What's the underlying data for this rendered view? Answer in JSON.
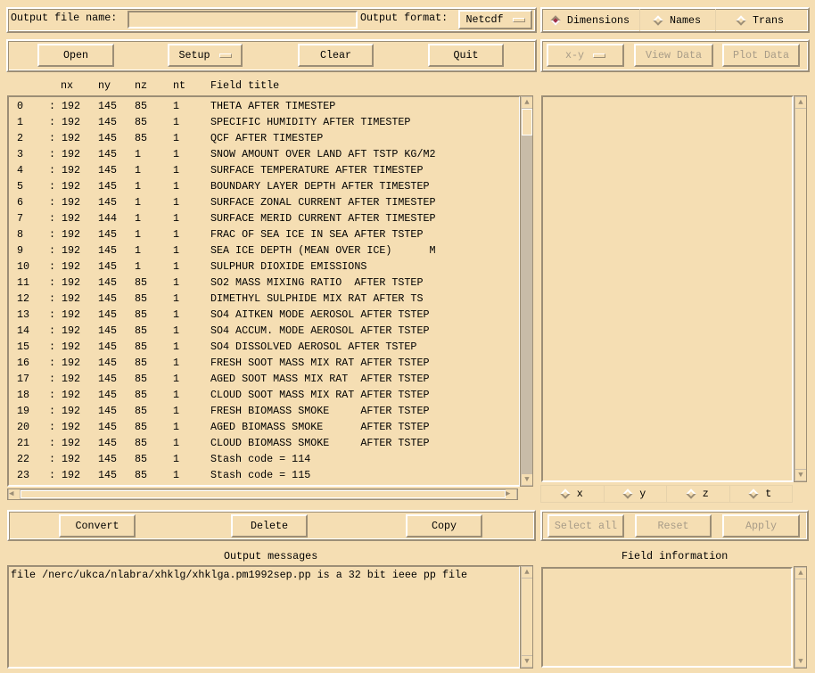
{
  "top": {
    "file_label": "Output file name:",
    "file_value": "",
    "format_label": "Output format:",
    "format_value": "Netcdf"
  },
  "view_modes": [
    {
      "label": "Dimensions",
      "selected": true
    },
    {
      "label": "Names",
      "selected": false
    },
    {
      "label": "Trans",
      "selected": false
    }
  ],
  "toolbar": {
    "open": "Open",
    "setup": "Setup",
    "clear": "Clear",
    "quit": "Quit"
  },
  "plot_toolbar": {
    "plot_type": "x-y",
    "view_data": "View Data",
    "plot_data": "Plot Data"
  },
  "list_header": {
    "nx": "nx",
    "ny": "ny",
    "nz": "nz",
    "nt": "nt",
    "title": "Field title"
  },
  "fields": [
    [
      "0",
      ": 192",
      "145",
      "85",
      "1",
      "THETA AFTER TIMESTEP"
    ],
    [
      "1",
      ": 192",
      "145",
      "85",
      "1",
      "SPECIFIC HUMIDITY AFTER TIMESTEP"
    ],
    [
      "2",
      ": 192",
      "145",
      "85",
      "1",
      "QCF AFTER TIMESTEP"
    ],
    [
      "3",
      ": 192",
      "145",
      "1",
      "1",
      "SNOW AMOUNT OVER LAND AFT TSTP KG/M2"
    ],
    [
      "4",
      ": 192",
      "145",
      "1",
      "1",
      "SURFACE TEMPERATURE AFTER TIMESTEP"
    ],
    [
      "5",
      ": 192",
      "145",
      "1",
      "1",
      "BOUNDARY LAYER DEPTH AFTER TIMESTEP"
    ],
    [
      "6",
      ": 192",
      "145",
      "1",
      "1",
      "SURFACE ZONAL CURRENT AFTER TIMESTEP"
    ],
    [
      "7",
      ": 192",
      "144",
      "1",
      "1",
      "SURFACE MERID CURRENT AFTER TIMESTEP"
    ],
    [
      "8",
      ": 192",
      "145",
      "1",
      "1",
      "FRAC OF SEA ICE IN SEA AFTER TSTEP"
    ],
    [
      "9",
      ": 192",
      "145",
      "1",
      "1",
      "SEA ICE DEPTH (MEAN OVER ICE)      M"
    ],
    [
      "10",
      ": 192",
      "145",
      "1",
      "1",
      "SULPHUR DIOXIDE EMISSIONS"
    ],
    [
      "11",
      ": 192",
      "145",
      "85",
      "1",
      "SO2 MASS MIXING RATIO  AFTER TSTEP"
    ],
    [
      "12",
      ": 192",
      "145",
      "85",
      "1",
      "DIMETHYL SULPHIDE MIX RAT AFTER TS"
    ],
    [
      "13",
      ": 192",
      "145",
      "85",
      "1",
      "SO4 AITKEN MODE AEROSOL AFTER TSTEP"
    ],
    [
      "14",
      ": 192",
      "145",
      "85",
      "1",
      "SO4 ACCUM. MODE AEROSOL AFTER TSTEP"
    ],
    [
      "15",
      ": 192",
      "145",
      "85",
      "1",
      "SO4 DISSOLVED AEROSOL AFTER TSTEP"
    ],
    [
      "16",
      ": 192",
      "145",
      "85",
      "1",
      "FRESH SOOT MASS MIX RAT AFTER TSTEP"
    ],
    [
      "17",
      ": 192",
      "145",
      "85",
      "1",
      "AGED SOOT MASS MIX RAT  AFTER TSTEP"
    ],
    [
      "18",
      ": 192",
      "145",
      "85",
      "1",
      "CLOUD SOOT MASS MIX RAT AFTER TSTEP"
    ],
    [
      "19",
      ": 192",
      "145",
      "85",
      "1",
      "FRESH BIOMASS SMOKE     AFTER TSTEP"
    ],
    [
      "20",
      ": 192",
      "145",
      "85",
      "1",
      "AGED BIOMASS SMOKE      AFTER TSTEP"
    ],
    [
      "21",
      ": 192",
      "145",
      "85",
      "1",
      "CLOUD BIOMASS SMOKE     AFTER TSTEP"
    ],
    [
      "22",
      ": 192",
      "145",
      "85",
      "1",
      "Stash code = 114"
    ],
    [
      "23",
      ": 192",
      "145",
      "85",
      "1",
      "Stash code = 115"
    ]
  ],
  "dims": [
    "x",
    "y",
    "z",
    "t"
  ],
  "actions": {
    "convert": "Convert",
    "delete": "Delete",
    "copy": "Copy"
  },
  "dim_actions": {
    "select_all": "Select all",
    "reset": "Reset",
    "apply": "Apply"
  },
  "messages": {
    "label": "Output messages",
    "text": "file /nerc/ukca/nlabra/xhklg/xhklga.pm1992sep.pp is a 32 bit ieee pp file"
  },
  "field_info": {
    "label": "Field information",
    "text": ""
  },
  "colors": {
    "background": "#f5deb3",
    "shadow": "#9c8e76",
    "toggle_selected": "#a0304a"
  }
}
